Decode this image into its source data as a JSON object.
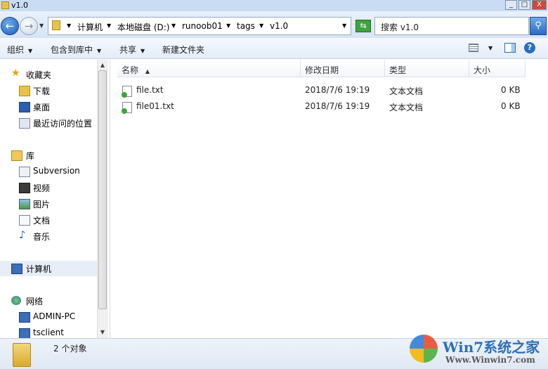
{
  "window": {
    "title": "v1.0",
    "minimize_label": "_",
    "maximize_label": "□",
    "close_label": "X"
  },
  "address": {
    "back_glyph": "←",
    "forward_glyph": "→",
    "crumbs": [
      "计算机",
      "本地磁盘 (D:)",
      "runoob01",
      "tags",
      "v1.0"
    ],
    "search_placeholder": "搜索 v1.0"
  },
  "toolbar": {
    "organize": "组织",
    "include_in_library": "包含到库中",
    "share": "共享",
    "new_folder": "新建文件夹"
  },
  "sidebar": {
    "favorites": "收藏夹",
    "downloads": "下载",
    "desktop": "桌面",
    "recent": "最近访问的位置",
    "libraries": "库",
    "subversion": "Subversion",
    "videos": "视频",
    "pictures": "图片",
    "documents": "文档",
    "music": "音乐",
    "computer": "计算机",
    "network": "网络",
    "admin_pc": "ADMIN-PC",
    "tsclient": "tsclient"
  },
  "columns": {
    "name": "名称",
    "modified": "修改日期",
    "type": "类型",
    "size": "大小"
  },
  "files": [
    {
      "name": "file.txt",
      "modified": "2018/7/6 19:19",
      "type": "文本文档",
      "size": "0 KB"
    },
    {
      "name": "file01.txt",
      "modified": "2018/7/6 19:19",
      "type": "文本文档",
      "size": "0 KB"
    }
  ],
  "status": {
    "count_text": "2 个对象"
  },
  "watermark": {
    "brand": "Win7系统之家",
    "url": "Www.Winwin7.com"
  },
  "colors": {
    "accent": "#2a6cc4",
    "titlebar": "#c9dcf3",
    "folder": "#e8c34a"
  }
}
